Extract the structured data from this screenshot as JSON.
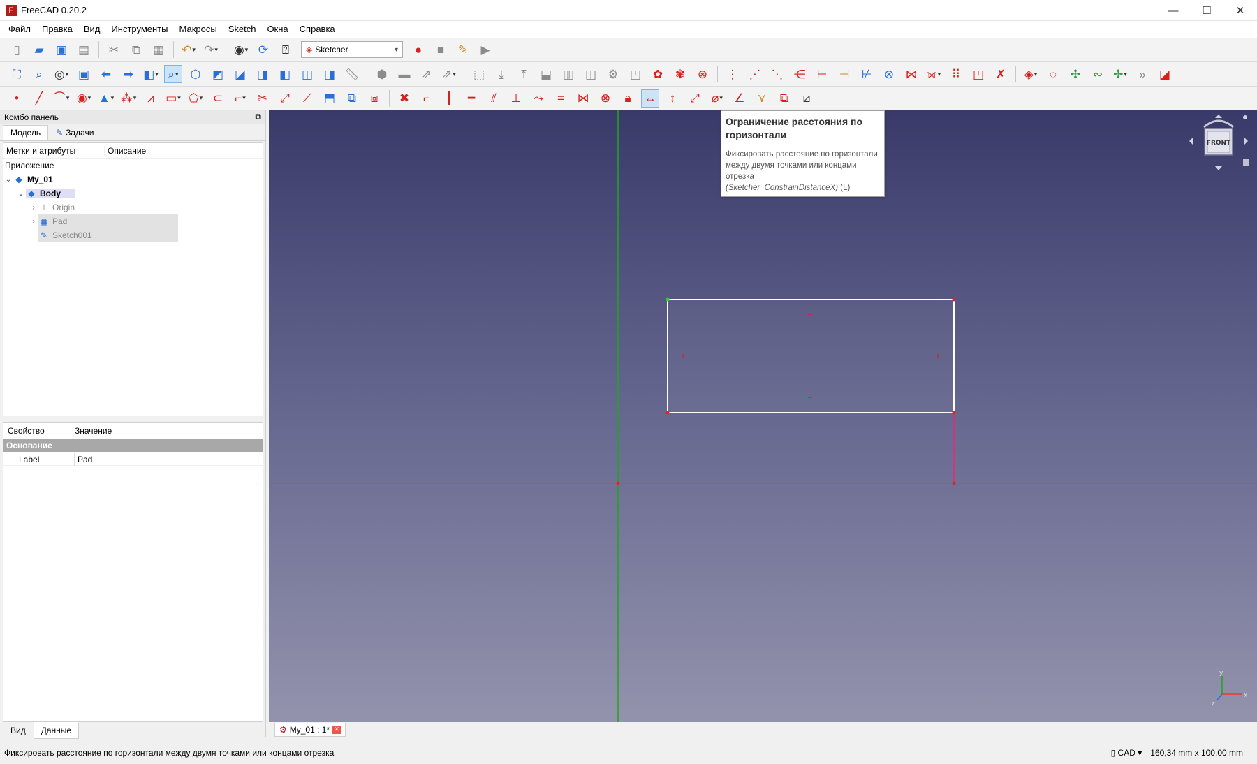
{
  "window": {
    "title": "FreeCAD 0.20.2",
    "logo_text": "F",
    "minimize": "—",
    "maximize": "☐",
    "close": "✕"
  },
  "menu": [
    "Файл",
    "Правка",
    "Вид",
    "Инструменты",
    "Макросы",
    "Sketch",
    "Окна",
    "Справка"
  ],
  "toolbar": {
    "workbench": "Sketcher"
  },
  "combo": {
    "title": "Комбо панель",
    "float_icon": "⧉",
    "tabs": [
      "Модель",
      "Задачи"
    ],
    "tree_columns": [
      "Метки и атрибуты",
      "Описание"
    ],
    "tree_root": "Приложение",
    "tree": [
      {
        "label": "My_01",
        "bold": true
      },
      {
        "label": "Body",
        "bold": true
      },
      {
        "label": "Origin"
      },
      {
        "label": "Pad"
      },
      {
        "label": "Sketch001"
      }
    ],
    "prop_columns": [
      "Свойство",
      "Значение"
    ],
    "prop_group": "Основание",
    "props": [
      {
        "key": "Label",
        "value": "Pad"
      }
    ],
    "bottom_tabs": [
      "Вид",
      "Данные"
    ]
  },
  "tooltip": {
    "title": "Ограничение расстояния по горизонтали",
    "description": "Фиксировать расстояние по горизонтали между двумя точками или концами отрезка",
    "command": "(Sketcher_ConstrainDistanceX)",
    "shortcut": " (L)"
  },
  "navcube": {
    "face": "FRONT"
  },
  "doc_tab": {
    "label": "My_01 : 1*"
  },
  "status": {
    "message": "Фиксировать расстояние по горизонтали между двумя точками или концами отрезка",
    "nav_style": "CAD",
    "dimensions": "160,34 mm x 100,00 mm"
  },
  "axis_labels": {
    "x": "x",
    "y": "y",
    "z": "z"
  },
  "colors": {
    "accent_red": "#d6201c",
    "accent_blue": "#2a6fd6",
    "axis_green": "#1fa51f",
    "axis_red": "#e83a3a",
    "sketch_line": "#ffffff",
    "constraint_pink": "#e8287a"
  }
}
